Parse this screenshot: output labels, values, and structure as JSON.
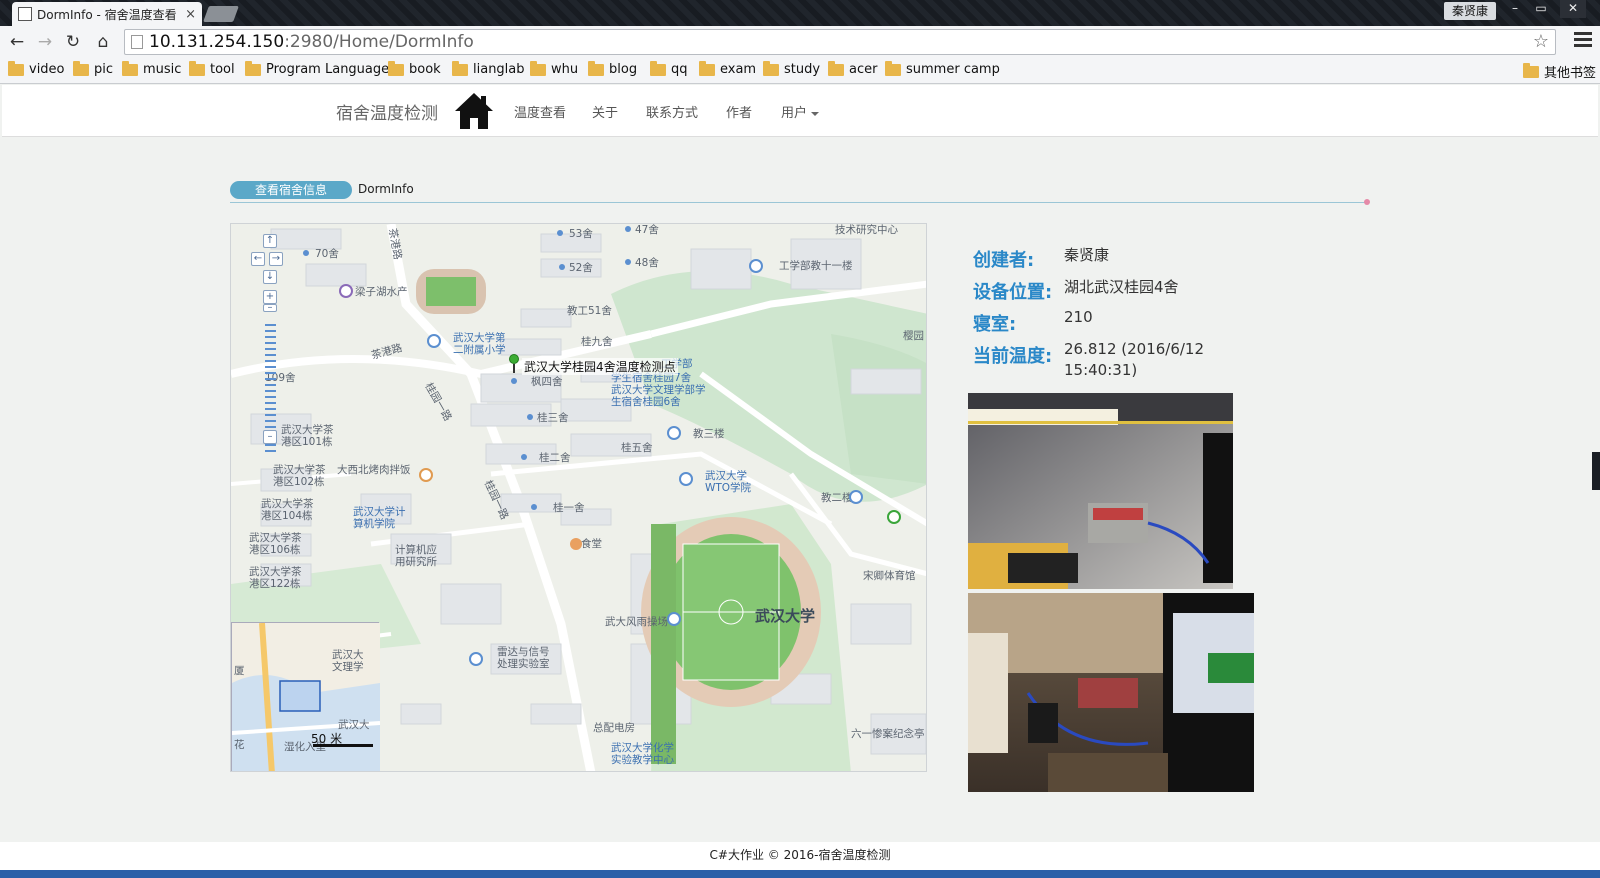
{
  "browser": {
    "tab_title": "DormInfo - 宿舍温度查看",
    "tab_close": "×",
    "user_name": "秦贤康",
    "window_controls": [
      "–",
      "▭",
      "✕"
    ],
    "url_host": "10.131.254.150",
    "url_rest": ":2980/Home/DormInfo",
    "bookmarks": [
      "video",
      "pic",
      "music",
      "tool",
      "Program Language",
      "book",
      "lianglab",
      "whu",
      "blog",
      "qq",
      "exam",
      "study",
      "acer",
      "summer camp"
    ],
    "other_bookmarks": "其他书签"
  },
  "site": {
    "brand": "宿舍温度检测",
    "nav": [
      "温度查看",
      "关于",
      "联系方式",
      "作者"
    ],
    "user_menu": "用户"
  },
  "breadcrumb": {
    "parent": "查看宿舍信息",
    "current": "DormInfo"
  },
  "map": {
    "marker_label": "武汉大学桂园4舍温度检测点",
    "scale_label": "50 米",
    "labels": {
      "l1": "70舍",
      "l2": "53舍",
      "l3": "47舍",
      "l4": "52舍",
      "l5": "48舍",
      "l6": "技术研究中心",
      "l7": "工学部教十一楼",
      "l8": "梁子湖水产",
      "l9": "教工51舍",
      "l10": "桂九舍",
      "l11": "武汉大学第二附属小学",
      "l12": "茶港路",
      "l13": "桂园一路",
      "l14": "109舍",
      "l15": "枫四舍",
      "l16": "学生宿舍桂园7舍",
      "l17": "武汉大学文理学部学生宿舍桂园6舍",
      "l18": "桂三舍",
      "l19": "教三楼",
      "l20": "武汉大学茶港区101栋",
      "l21": "桂二舍",
      "l22": "桂五舍",
      "l23": "大西北烤肉拌饭",
      "l24": "武汉大学茶港区102栋",
      "l25": "武汉大学WTO学院",
      "l26": "教二楼",
      "l27": "桂一舍",
      "l28": "武汉大学茶港区104栋",
      "l29": "武汉大学计算机学院",
      "l30": "食堂",
      "l31": "计算机应用研究所",
      "l32": "武汉大学茶港区106栋",
      "l33": "宋卿体育馆",
      "l34": "武汉大学茶港区122栋",
      "l35": "武汉大学",
      "l36": "武大风雨操场",
      "l37": "雷达与信号处理实验室",
      "l38": "总配电房",
      "l39": "六一惨案纪念亭",
      "l40": "武汉大学化学实验教学中心",
      "l41": "樱园",
      "l42": "茶港路",
      "l43": "桂园一路",
      "l44": "工学部",
      "ov1": "武汉大文理学",
      "ov2": "武汉大",
      "ov3": "厦",
      "ov4": "花",
      "ov5": "湿化入里"
    }
  },
  "info": {
    "creator_label": "创建者:",
    "creator": "秦贤康",
    "location_label": "设备位置:",
    "location": "湖北武汉桂园4舍",
    "room_label": "寝室:",
    "room": "210",
    "temp_label": "当前温度:",
    "temp_line1": "26.812 (2016/6/12",
    "temp_line2": "15:40:31)"
  },
  "footer": "C#大作业 © 2016-宿舍温度检测",
  "colors": {
    "accent": "#2a88c8",
    "breadcrumb_pill": "#5ba8c8",
    "page_bg": "#f0f2f0"
  }
}
